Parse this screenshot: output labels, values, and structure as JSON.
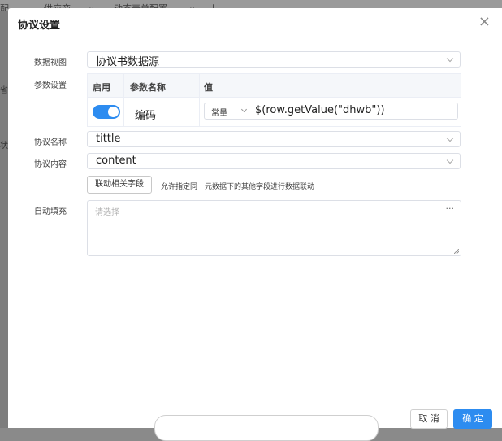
{
  "background": {
    "tabs": [
      {
        "label": "配",
        "icon": "close-icon"
      },
      {
        "label": "供应商",
        "icon": "close-icon"
      },
      {
        "label": "动态表单配置",
        "icon": "close-icon"
      }
    ],
    "add_tab_glyph": "+",
    "left_fragments": [
      "省",
      "状"
    ]
  },
  "dialog": {
    "title": "协议设置",
    "close_glyph": "×",
    "data_view": {
      "label": "数据视图",
      "value": "协议书数据源"
    },
    "params": {
      "label": "参数设置",
      "headers": [
        "启用",
        "参数名称",
        "值"
      ],
      "rows": [
        {
          "enabled": true,
          "name": "编码",
          "type": "常量",
          "expression": "$(row.getValue(\"dhwb\"))"
        }
      ]
    },
    "protocol_name": {
      "label": "协议名称",
      "value": "tittle"
    },
    "protocol_content": {
      "label": "协议内容",
      "value": "content"
    },
    "link_fields": {
      "button_label": "联动相关字段",
      "hint": "允许指定同一元数据下的其他字段进行数据联动"
    },
    "autofill": {
      "label": "自动填充",
      "placeholder": "请选择",
      "more_glyph": "···"
    },
    "footer": {
      "cancel_label": "取 消",
      "ok_label": "确 定"
    }
  },
  "colors": {
    "accent": "#2d8cf0",
    "overlay": "#8a8a8a"
  }
}
